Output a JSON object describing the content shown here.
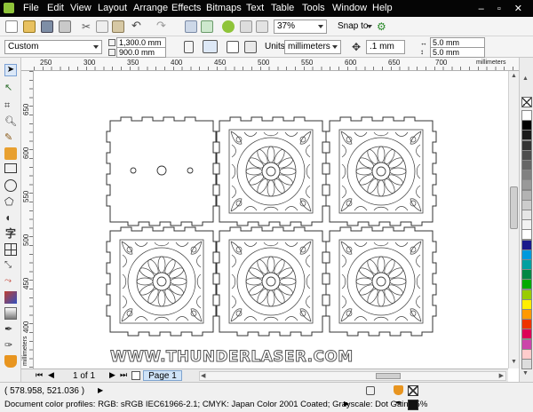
{
  "menu": [
    "File",
    "Edit",
    "View",
    "Layout",
    "Arrange",
    "Effects",
    "Bitmaps",
    "Text",
    "Table",
    "Tools",
    "Window",
    "Help"
  ],
  "toolbar": {
    "zoom_value": "37%",
    "snap_label": "Snap to"
  },
  "property_bar": {
    "page_preset": "Custom",
    "width": "1,300.0 mm",
    "height": "900.0 mm",
    "units_label": "Units:",
    "units_value": "millimeters",
    "nudge": ".1 mm",
    "dup_x": "5.0 mm",
    "dup_y": "5.0 mm"
  },
  "rulers": {
    "units_caption": "millimeters",
    "top_ticks": [
      "250",
      "300",
      "350",
      "400",
      "450",
      "500",
      "550",
      "600",
      "650",
      "700"
    ],
    "left_ticks": [
      "650",
      "600",
      "550",
      "500",
      "450",
      "400"
    ],
    "left_caption": "millimeters"
  },
  "canvas": {
    "watermark": "WWW.THUNDERLASER.COM"
  },
  "page_nav": {
    "counter": "1 of 1",
    "tab": "Page 1"
  },
  "status": {
    "coords": "( 578.958, 521.036 )",
    "color_profiles": "Document color profiles: RGB: sRGB IEC61966-2.1; CMYK: Japan Color 2001 Coated; Grayscale: Dot Gain 15%"
  },
  "palette_colors": [
    "#ffffff",
    "#000000",
    "#1a1a1a",
    "#333333",
    "#4d4d4d",
    "#666666",
    "#808080",
    "#999999",
    "#b3b3b3",
    "#cccccc",
    "#e6e6e6",
    "#f2f2f2",
    "#ffffff",
    "#1a1a8c",
    "#0099dd",
    "#00a0a0",
    "#008844",
    "#00aa00",
    "#99cc00",
    "#ffee00",
    "#ff9900",
    "#ee3300",
    "#dd0055",
    "#cc44aa",
    "#ffcccc",
    "#dddddd"
  ],
  "accent": {
    "menubar_bg": "#050505",
    "page_tab": "#cfe3f7"
  }
}
